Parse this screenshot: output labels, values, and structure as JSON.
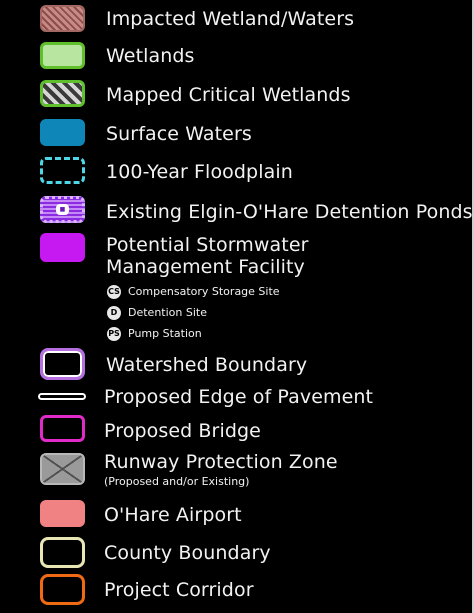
{
  "legend": {
    "items": [
      {
        "label": "Impacted Wetland/Waters"
      },
      {
        "label": "Wetlands"
      },
      {
        "label": "Mapped Critical Wetlands"
      },
      {
        "label": "Surface Waters"
      },
      {
        "label": "100-Year Floodplain"
      },
      {
        "label": "Existing Elgin-O'Hare Detention Ponds"
      },
      {
        "label_line1": "Potential Stormwater",
        "label_line2": "Management Facility"
      },
      {
        "label": "Watershed Boundary"
      },
      {
        "label": "Proposed Edge of Pavement"
      },
      {
        "label": "Proposed Bridge"
      },
      {
        "label": "Runway Protection Zone",
        "sublabel": "(Proposed and/or Existing)"
      },
      {
        "label": "O'Hare Airport"
      },
      {
        "label": "County Boundary"
      },
      {
        "label": "Project Corridor"
      }
    ],
    "facility_types": [
      {
        "icon": "CS",
        "label": "Compensatory Storage Site"
      },
      {
        "icon": "D",
        "label": "Detention Site"
      },
      {
        "icon": "PS",
        "label": "Pump Station"
      }
    ],
    "colors": {
      "background": "#000000",
      "impacted": "#c98a85",
      "wetlands": "#b8e6a0",
      "wetland_border": "#5fbf2c",
      "surface_waters": "#0f86b8",
      "floodplain": "#4fd6e6",
      "detention_ponds": "#8a2be2",
      "potential_stormwater": "#c619f2",
      "watershed": "#b66fe0",
      "bridge": "#e02bc9",
      "runway": "#9a9a9a",
      "ohare": "#f08284",
      "county": "#e8e6b4",
      "corridor": "#f06a14"
    }
  }
}
